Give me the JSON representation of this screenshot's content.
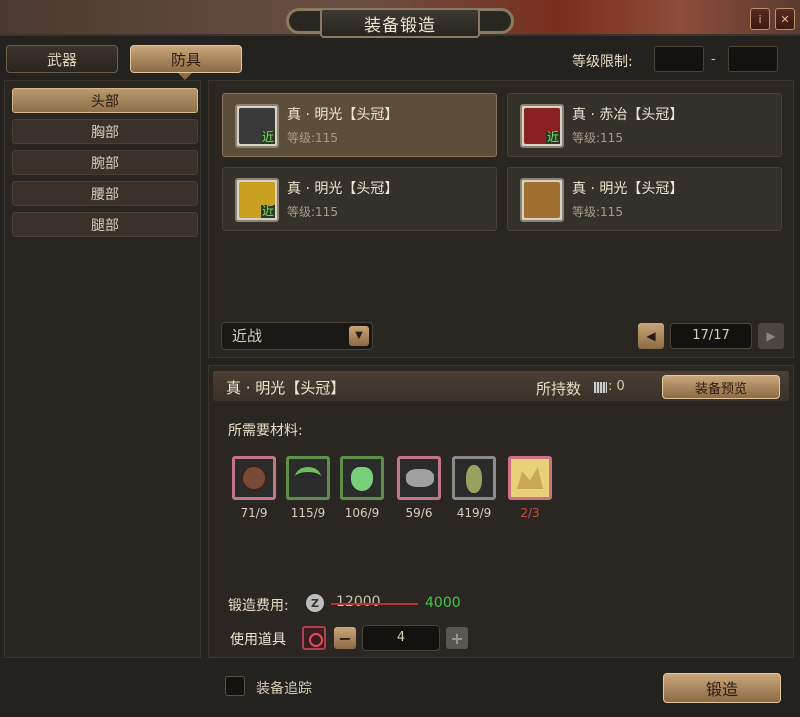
{
  "window": {
    "title": "装备锻造",
    "info_icon": "i",
    "close_icon": "✕"
  },
  "tabs": [
    {
      "label": "武器",
      "active": false
    },
    {
      "label": "防具",
      "active": true
    }
  ],
  "level_filter": {
    "label": "等级限制:",
    "min": "",
    "max": "",
    "separator": "-"
  },
  "sidebar": {
    "items": [
      {
        "label": "头部",
        "active": true
      },
      {
        "label": "胸部",
        "active": false
      },
      {
        "label": "腕部",
        "active": false
      },
      {
        "label": "腰部",
        "active": false
      },
      {
        "label": "腿部",
        "active": false
      }
    ]
  },
  "cards": [
    {
      "name": "真 · 明光【头冠】",
      "level": "等级:115",
      "badge": "近",
      "selected": true,
      "icon": "helmet-icon",
      "icon_color": "#3a3a3a"
    },
    {
      "name": "真 · 赤冶【头冠】",
      "level": "等级:115",
      "badge": "近",
      "selected": false,
      "icon": "helmet-red-icon",
      "icon_color": "#8a2020"
    },
    {
      "name": "真 · 明光【头冠】",
      "level": "等级:115",
      "badge": "近",
      "selected": false,
      "icon": "helmet-gold-icon",
      "icon_color": "#c9a020"
    },
    {
      "name": "真 · 明光【头冠】",
      "level": "等级:115",
      "badge": "",
      "selected": false,
      "icon": "helmet-bronze-icon",
      "icon_color": "#a07030"
    }
  ],
  "filter": {
    "selected": "近战"
  },
  "pagination": {
    "page": "17/17",
    "prev": "◀",
    "next": "▶"
  },
  "detail": {
    "name": "真 · 明光【头冠】",
    "owned_label": "所持数",
    "owned_value": ": 0",
    "preview_label": "装备预览",
    "materials_label": "所需要材料:",
    "materials": [
      {
        "icon": "shell-material-icon",
        "count": "71/9",
        "color": "pink",
        "enough": true
      },
      {
        "icon": "claw-material-icon",
        "count": "115/9",
        "color": "green",
        "enough": true
      },
      {
        "icon": "potion-material-icon",
        "count": "106/9",
        "color": "green",
        "enough": true
      },
      {
        "icon": "skull-material-icon",
        "count": "59/6",
        "color": "pink",
        "enough": true
      },
      {
        "icon": "insect-material-icon",
        "count": "419/9",
        "color": "gray",
        "enough": true
      },
      {
        "icon": "scroll-material-icon",
        "count": "2/3",
        "color": "hl",
        "enough": false
      }
    ],
    "cost_label": "锻造费用:",
    "cost_icon": "Z",
    "old_cost": "12000",
    "new_cost": "4000",
    "use_item_label": "使用道具",
    "quantity": "4",
    "minus": "−",
    "plus": "+"
  },
  "tracking": {
    "label": "装备追踪"
  },
  "forge_button": {
    "label": "锻造"
  }
}
